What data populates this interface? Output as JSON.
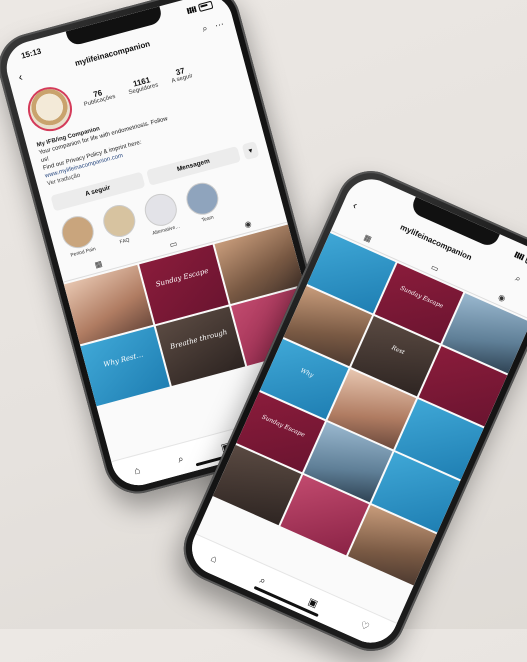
{
  "phone1": {
    "status": {
      "time": "15:13"
    },
    "header": {
      "username": "mylifeinacompanion"
    },
    "profile": {
      "stats": [
        {
          "num": "76",
          "label": "Publicações"
        },
        {
          "num": "1161",
          "label": "Seguidores"
        },
        {
          "num": "37",
          "label": "A seguir"
        }
      ],
      "bio": {
        "name": "My IFB/ing Companion",
        "line1": "Your companion for life with endometriosis. Follow",
        "line2": "us!",
        "line3": "Find our Privacy Policy & imprint here:",
        "link": "www.mylifeinacompanion.com",
        "sub": "Ver tradução"
      },
      "buttons": {
        "follow": "A seguir",
        "message": "Mensagem",
        "more": "▾"
      },
      "highlights": [
        {
          "label": "Period Pain",
          "color": "#c9a57d"
        },
        {
          "label": "FAQ",
          "color": "#d7c3a0"
        },
        {
          "label": "Alternative…",
          "color": "#e3e3e8"
        },
        {
          "label": "Team",
          "color": "#8fa4bd"
        }
      ]
    },
    "tabs": [
      "▦",
      "▭",
      "◉"
    ],
    "grid": [
      {
        "color": "c-photo3",
        "text": ""
      },
      {
        "color": "c-maroon",
        "text": "Sunday Escape"
      },
      {
        "color": "c-photo1",
        "text": ""
      },
      {
        "color": "c-blue",
        "text": "Why Rest…"
      },
      {
        "color": "c-dark",
        "text": "Breathe through"
      },
      {
        "color": "c-pink",
        "text": ""
      }
    ],
    "bottomnav": [
      "⌂",
      "⌕",
      "▣",
      "♡",
      "●"
    ]
  },
  "phone2": {
    "header": {
      "username": "mylifeinacompanion"
    },
    "tabs": [
      "▦",
      "▭",
      "◉"
    ],
    "grid": [
      {
        "color": "c-blue",
        "text": ""
      },
      {
        "color": "c-maroon",
        "text": "Sunday Escape"
      },
      {
        "color": "c-photo2",
        "text": ""
      },
      {
        "color": "c-photo1",
        "text": ""
      },
      {
        "color": "c-dark",
        "text": "Rest"
      },
      {
        "color": "c-maroon",
        "text": ""
      },
      {
        "color": "c-blue",
        "text": "Why"
      },
      {
        "color": "c-photo3",
        "text": ""
      },
      {
        "color": "c-blue",
        "text": ""
      },
      {
        "color": "c-maroon",
        "text": "Sunday Escape"
      },
      {
        "color": "c-photo2",
        "text": ""
      },
      {
        "color": "c-blue",
        "text": ""
      },
      {
        "color": "c-dark",
        "text": ""
      },
      {
        "color": "c-pink",
        "text": ""
      },
      {
        "color": "c-photo1",
        "text": ""
      }
    ],
    "bottomnav": [
      "⌂",
      "⌕",
      "▣",
      "♡"
    ]
  }
}
